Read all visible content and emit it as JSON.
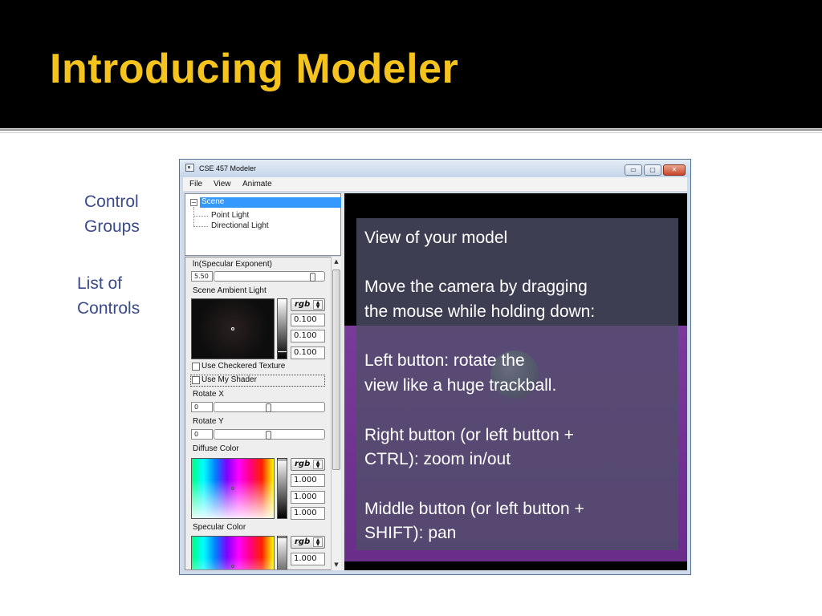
{
  "slide": {
    "title": "Introducing Modeler",
    "labels": {
      "control_groups_1": "Control",
      "control_groups_2": "Groups",
      "list_controls_1": "List of",
      "list_controls_2": "Controls"
    }
  },
  "window": {
    "title": "CSE 457 Modeler",
    "controls": {
      "minimize": "▭",
      "maximize": "▢",
      "close": "✕"
    },
    "menu": [
      "File",
      "View",
      "Animate"
    ]
  },
  "tree": {
    "root": "Scene",
    "expander": "−",
    "children": [
      "Point Light",
      "Directional Light"
    ]
  },
  "controls": {
    "specular_exponent": {
      "label": "ln(Specular Exponent)",
      "value": "5.50",
      "position": 0.93
    },
    "ambient": {
      "label": "Scene Ambient Light",
      "mode": "rgb",
      "values": [
        "0.100",
        "0.100",
        "0.100"
      ],
      "brightness": 0.9
    },
    "checkered": {
      "label": "Use Checkered Texture",
      "checked": false
    },
    "shader": {
      "label": "Use My Shader",
      "checked": false
    },
    "rotate_x": {
      "label": "Rotate X",
      "value": "0",
      "position": 0.5
    },
    "rotate_y": {
      "label": "Rotate Y",
      "value": "0",
      "position": 0.5
    },
    "diffuse": {
      "label": "Diffuse Color",
      "mode": "rgb",
      "values": [
        "1.000",
        "1.000",
        "1.000"
      ]
    },
    "specular": {
      "label": "Specular Color",
      "mode": "rgb",
      "values": [
        "1.000"
      ]
    }
  },
  "viewport": {
    "lines": [
      [
        "View of your model"
      ],
      [
        "Move the camera by dragging",
        "the mouse while holding down:"
      ],
      [
        "Left button: rotate the",
        "view like a huge trackball."
      ],
      [
        "Right button (or left button +",
        "CTRL): zoom in/out"
      ],
      [
        "Middle button (or left button +",
        "SHIFT): pan"
      ]
    ]
  },
  "colors": {
    "title": "#f5c31d",
    "label": "#3b4a8a",
    "selection": "#3399ff",
    "viewport_band": "#7a3a9c"
  }
}
